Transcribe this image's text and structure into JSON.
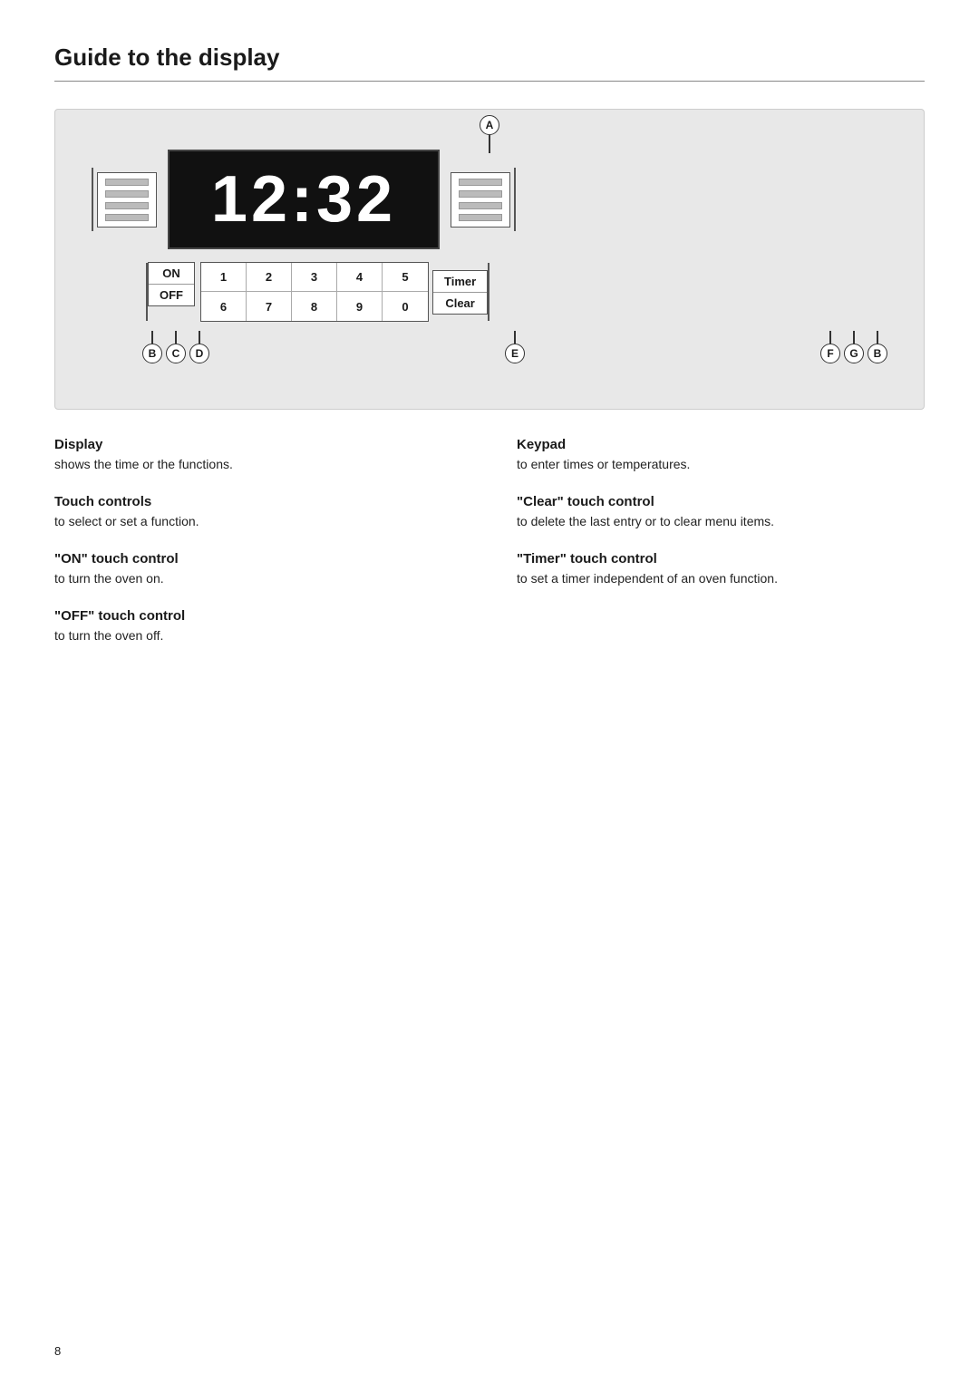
{
  "page": {
    "title": "Guide to the display",
    "page_number": "8"
  },
  "diagram": {
    "label_a": "A",
    "display_time": "12:32",
    "on_button": "ON",
    "off_button": "OFF",
    "keypad_row1": [
      "1",
      "2",
      "3",
      "4",
      "5"
    ],
    "keypad_row2": [
      "6",
      "7",
      "8",
      "9",
      "0"
    ],
    "timer_button": "Timer",
    "clear_button": "Clear",
    "bottom_labels": [
      "B",
      "C",
      "D",
      "E",
      "F",
      "G",
      "B"
    ]
  },
  "content": {
    "left_col": [
      {
        "title": "Display",
        "desc": "shows the time or the functions."
      },
      {
        "title": "Touch controls",
        "desc": "to select or set a function."
      },
      {
        "title": "\"ON\" touch control",
        "desc": "to turn the oven on."
      },
      {
        "title": "\"OFF\" touch control",
        "desc": "to turn the oven off."
      }
    ],
    "right_col": [
      {
        "title": "Keypad",
        "desc": "to enter times or temperatures."
      },
      {
        "title": "\"Clear\" touch control",
        "desc": "to delete the last entry or to clear menu items."
      },
      {
        "title": "\"Timer\" touch control",
        "desc": "to set a timer independent of an oven function."
      }
    ]
  }
}
